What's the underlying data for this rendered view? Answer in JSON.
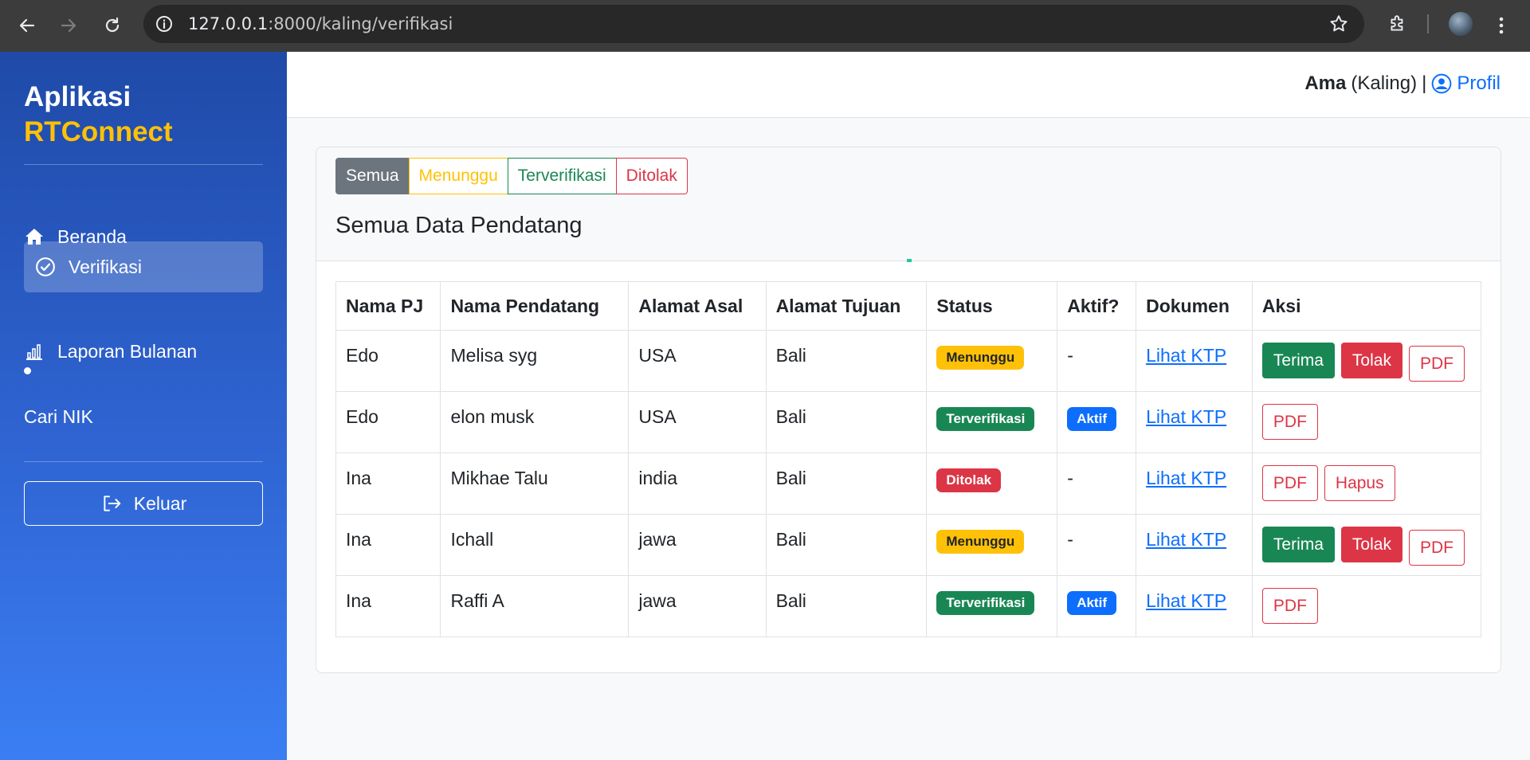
{
  "browser": {
    "url_host": "127.0.0.1",
    "url_path": ":8000/kaling/verifikasi"
  },
  "sidebar": {
    "brand_line1": "Aplikasi",
    "brand_line2": "RTConnect",
    "items": [
      {
        "label": "Beranda",
        "icon": "home-icon"
      },
      {
        "label": "Verifikasi",
        "icon": "check-circle-icon",
        "active": true
      },
      {
        "label": "Laporan Bulanan",
        "icon": "bar-chart-icon"
      },
      {
        "label": "Cari NIK"
      }
    ],
    "logout_label": "Keluar"
  },
  "topbar": {
    "user_name": "Ama",
    "user_role": "(Kaling)",
    "separator": "|",
    "profile_label": "Profil"
  },
  "filters": [
    "Semua",
    "Menunggu",
    "Terverifikasi",
    "Ditolak"
  ],
  "card_title": "Semua Data Pendatang",
  "table": {
    "headers": [
      "Nama PJ",
      "Nama Pendatang",
      "Alamat Asal",
      "Alamat Tujuan",
      "Status",
      "Aktif?",
      "Dokumen",
      "Aksi"
    ],
    "rows": [
      {
        "pj": "Edo",
        "pendatang": "Melisa syg",
        "asal": "USA",
        "tujuan": "Bali",
        "status": "Menunggu",
        "aktif": "-",
        "dokumen": "Lihat KTP",
        "actions": [
          "Terima",
          "Tolak",
          "PDF"
        ]
      },
      {
        "pj": "Edo",
        "pendatang": "elon musk",
        "asal": "USA",
        "tujuan": "Bali",
        "status": "Terverifikasi",
        "aktif": "Aktif",
        "dokumen": "Lihat KTP",
        "actions": [
          "PDF"
        ]
      },
      {
        "pj": "Ina",
        "pendatang": "Mikhae Talu",
        "asal": "india",
        "tujuan": "Bali",
        "status": "Ditolak",
        "aktif": "-",
        "dokumen": "Lihat KTP",
        "actions": [
          "PDF",
          "Hapus"
        ]
      },
      {
        "pj": "Ina",
        "pendatang": "Ichall",
        "asal": "jawa",
        "tujuan": "Bali",
        "status": "Menunggu",
        "aktif": "-",
        "dokumen": "Lihat KTP",
        "actions": [
          "Terima",
          "Tolak",
          "PDF"
        ]
      },
      {
        "pj": "Ina",
        "pendatang": "Raffi A",
        "asal": "jawa",
        "tujuan": "Bali",
        "status": "Terverifikasi",
        "aktif": "Aktif",
        "dokumen": "Lihat KTP",
        "actions": [
          "PDF"
        ]
      }
    ]
  },
  "colors": {
    "primary": "#0d6efd",
    "success": "#198754",
    "danger": "#dc3545",
    "warning": "#ffc107",
    "secondary": "#6c757d"
  }
}
